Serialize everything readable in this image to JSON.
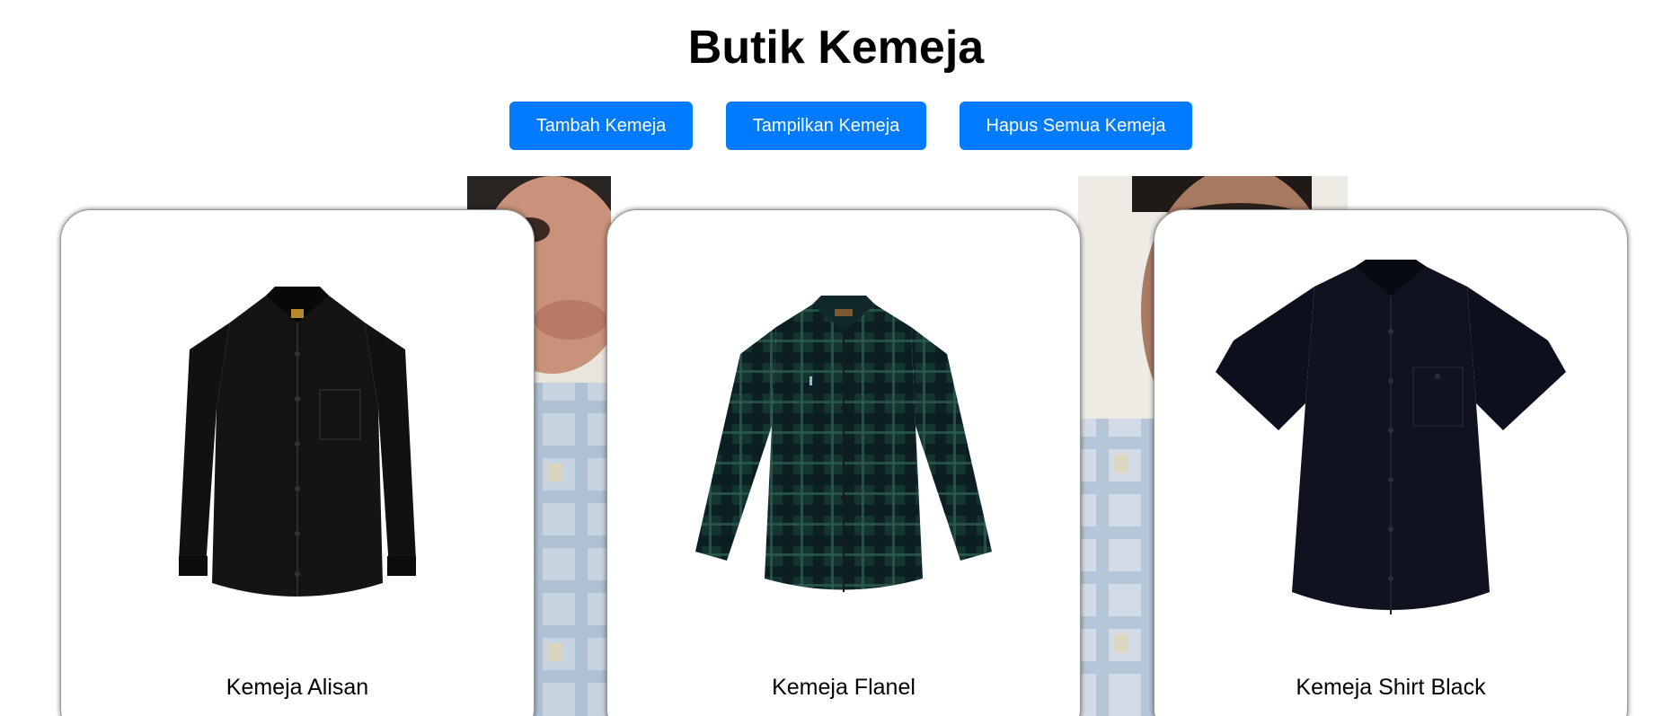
{
  "header": {
    "title": "Butik Kemeja"
  },
  "toolbar": {
    "add_label": "Tambah Kemeja",
    "show_label": "Tampilkan Kemeja",
    "clear_label": "Hapus Semua Kemeja"
  },
  "products": [
    {
      "name": "Kemeja Alisan",
      "icon": "black-long-sleeve-shirt-image",
      "color": "#111111"
    },
    {
      "name": "Kemeja Flanel",
      "icon": "green-plaid-flannel-shirt-image",
      "color": "#14342f"
    },
    {
      "name": "Kemeja Shirt Black",
      "icon": "black-short-sleeve-shirt-image",
      "color": "#0c0f1c"
    }
  ],
  "colors": {
    "accent": "#007bff",
    "button_text": "#ffffff"
  }
}
